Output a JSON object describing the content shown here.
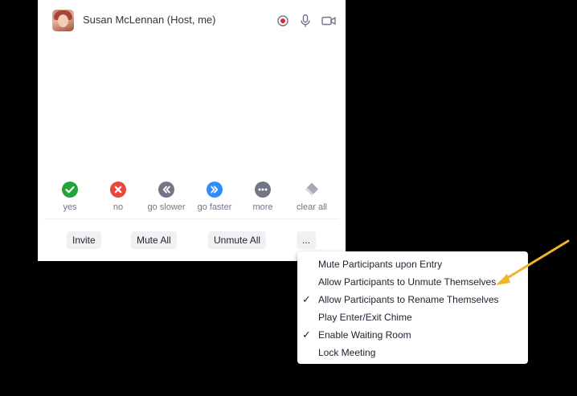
{
  "participant": {
    "name": "Susan McLennan (Host, me)",
    "icons": [
      "record-icon",
      "microphone-icon",
      "video-camera-icon"
    ],
    "record_color": "#e02828"
  },
  "reactions": [
    {
      "id": "yes",
      "label": "yes",
      "icon": "check-icon",
      "color": "#23a33a"
    },
    {
      "id": "no",
      "label": "no",
      "icon": "x-icon",
      "color": "#e8473a"
    },
    {
      "id": "go-slower",
      "label": "go slower",
      "icon": "double-chevron-left-icon",
      "color": "#747487"
    },
    {
      "id": "go-faster",
      "label": "go faster",
      "icon": "double-chevron-right-icon",
      "color": "#2d8cff"
    },
    {
      "id": "more",
      "label": "more",
      "icon": "ellipsis-icon",
      "color": "#747487"
    },
    {
      "id": "clear-all",
      "label": "clear all",
      "icon": "eraser-icon",
      "color": "#a8a8b5"
    }
  ],
  "actions": {
    "invite": "Invite",
    "mute_all": "Mute All",
    "unmute_all": "Unmute All",
    "more": "..."
  },
  "menu": {
    "items": [
      {
        "label": "Mute Participants upon Entry",
        "checked": false
      },
      {
        "label": "Allow Participants to Unmute Themselves",
        "checked": false
      },
      {
        "label": "Allow Participants to Rename Themselves",
        "checked": true
      },
      {
        "label": "Play Enter/Exit Chime",
        "checked": false
      },
      {
        "label": "Enable Waiting Room",
        "checked": true
      },
      {
        "label": "Lock Meeting",
        "checked": false
      }
    ]
  },
  "annotation": {
    "arrow_color": "#f0b429",
    "icon": "arrow-pointer-icon"
  }
}
